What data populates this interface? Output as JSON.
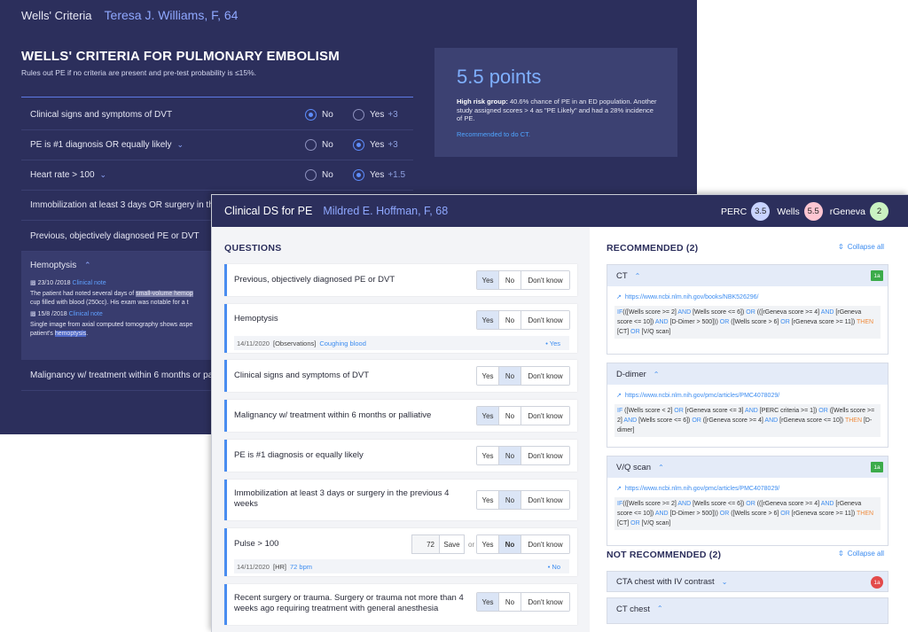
{
  "back": {
    "app_title": "Wells' Criteria",
    "patient": "Teresa J. Williams, F, 64",
    "heading": "WELLS' CRITERIA FOR PULMONARY EMBOLISM",
    "subheading": "Rules out PE if no criteria are present and pre-test probability is ≤15%.",
    "criteria": [
      {
        "label": "Clinical signs and symptoms of DVT",
        "no": "No",
        "yes": "Yes",
        "pts": "+3",
        "selected": "no"
      },
      {
        "label": "PE is #1 diagnosis OR equally likely",
        "no": "No",
        "yes": "Yes",
        "pts": "+3",
        "selected": "yes"
      },
      {
        "label": "Heart rate > 100",
        "no": "No",
        "yes": "Yes",
        "pts": "+1.5",
        "selected": "yes"
      },
      {
        "label": "Immobilization at least 3 days OR surgery in the"
      },
      {
        "label": "Previous, objectively diagnosed PE or DVT"
      }
    ],
    "hemoptysis": {
      "label": "Hemoptysis",
      "note1_date": "23/10 /2018",
      "note1_type": "Clinical note",
      "note1_line1_a": "The patient had noted several days of ",
      "note1_line1_hl": "small-volume hemop",
      "note1_line2": "cup filled with blood (250cc). His exam was notable for a t",
      "note2_date": "15/8 /2018",
      "note2_type": "Clinical note",
      "note2_line1": "Single image from axial computed tomography shows aspe",
      "note2_line2_a": "patient's ",
      "note2_line2_hl": "hemoptysis",
      "note2_line2_b": "."
    },
    "malignancy_label": "Malignancy w/ treatment within 6 months or pa",
    "score": {
      "points": "5.5 points",
      "risk_bold": "High risk group:",
      "risk_text": " 40.6% chance of PE in an ED population. Another study assigned scores > 4 as \"PE Likely\" and had a 28% incidence of PE.",
      "recommend": "Recommended to do CT."
    }
  },
  "front": {
    "app_title": "Clinical DS for PE",
    "patient": "Mildred E. Hoffman, F, 68",
    "scores": [
      {
        "label": "PERC",
        "value": "3.5"
      },
      {
        "label": "Wells",
        "value": "5.5"
      },
      {
        "label": "rGeneva",
        "value": "2"
      }
    ],
    "questions_title": "QUESTIONS",
    "options": {
      "yes": "Yes",
      "no": "No",
      "dk": "Don't know"
    },
    "questions": [
      {
        "text": "Previous, objectively diagnosed PE or DVT",
        "selected": "yes"
      },
      {
        "text": "Hemoptysis",
        "selected": "yes",
        "obs_date": "14/11/2020",
        "obs_src": "[Observations]",
        "obs_val": "Coughing blood",
        "obs_ans": "• Yes"
      },
      {
        "text": "Clinical signs and symptoms of DVT",
        "selected": "no"
      },
      {
        "text": "Malignancy w/ treatment within 6 months or palliative",
        "selected": "yes"
      },
      {
        "text": "PE is #1 diagnosis or equally likely",
        "selected": "no"
      },
      {
        "text": "Immobilization at least 3 days or surgery in the previous 4 weeks",
        "selected": "no"
      },
      {
        "text": "Pulse > 100",
        "selected": "no",
        "input_value": "72",
        "save": "Save",
        "or": "or",
        "obs_date": "14/11/2020",
        "obs_src": "[HR]",
        "obs_val": "72 bpm",
        "obs_ans": "• No"
      },
      {
        "text": "Recent surgery or trauma. Surgery or trauma not more than 4 weeks ago requiring treatment with general anesthesia",
        "selected": "yes"
      }
    ],
    "recommended_title": "RECOMMENDED (2)",
    "collapse_all": "Collapse all",
    "recommended": [
      {
        "name": "CT",
        "badge": "1a",
        "link": "https://www.ncbi.nlm.nih.gov/books/NBK526296/",
        "rule_html": "<span class='kw'>IF</span>(([Wells score >= 2] <span class='kw'>AND</span> [Wells score <= 6]) <span class='kw'>OR</span> (([rGeneva score >= 4] <span class='kw'>AND</span> [rGeneva score <= 10]) <span class='kw'>AND</span> [D-Dimer > 500])) <span class='kw'>OR</span> ([Wells score > 6] <span class='kw'>OR</span> [rGeneva score >= 11]) <span class='th'>THEN</span> [CT] <span class='kw'>OR</span> [V/Q scan]"
      },
      {
        "name": "D-dimer",
        "badge": "",
        "link": "https://www.ncbi.nlm.nih.gov/pmc/articles/PMC4078029/",
        "rule_html": "<span class='kw'>IF</span> ([Wells score < 2] <span class='kw'>OR</span> [rGeneva score <= 3] <span class='kw'>AND</span> [PERC criteria >= 1]) <span class='kw'>OR</span> ([Wells score >= 2] <span class='kw'>AND</span> [Wells score <= 6]) <span class='kw'>OR</span> ([rGeneva score >= 4] <span class='kw'>AND</span> [rGeneva score <= 10]) <span class='th'>THEN</span> [D-dimer]"
      },
      {
        "name": "V/Q scan",
        "badge": "1a",
        "link": "https://www.ncbi.nlm.nih.gov/pmc/articles/PMC4078029/",
        "rule_html": "<span class='kw'>IF</span>(([Wells score >= 2] <span class='kw'>AND</span> [Wells score <= 6]) <span class='kw'>OR</span> (([rGeneva score >= 4] <span class='kw'>AND</span> [rGeneva score <= 10]) <span class='kw'>AND</span> [D-Dimer > 500])) <span class='kw'>OR</span> ([Wells score > 6] <span class='kw'>OR</span> [rGeneva score >= 11]) <span class='th'>THEN</span> [CT] <span class='kw'>OR</span> [V/Q scan]"
      }
    ],
    "not_recommended_title": "NOT RECOMMENDED (2)",
    "not_recommended": [
      {
        "name": "CTA chest with IV contrast",
        "badge": "1a"
      },
      {
        "name": "CT chest"
      }
    ],
    "colors": {
      "navy": "#2c2f5c",
      "accent": "#3c8cf0",
      "green_badge": "#3bab4a",
      "red_badge": "#e34a4a"
    }
  }
}
